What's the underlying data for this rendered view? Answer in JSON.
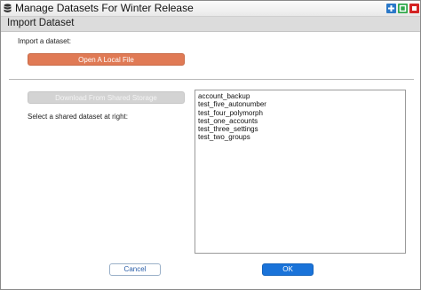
{
  "window": {
    "title": "Manage Datasets For Winter Release",
    "app_icon": "database-icon",
    "controls": {
      "maximize_icon": "plus-icon",
      "restore_icon": "square-icon",
      "close_icon": "close-icon"
    }
  },
  "header": {
    "title": "Import Dataset"
  },
  "import_section": {
    "label": "Import a dataset:",
    "local_button": "Open A Local File"
  },
  "shared_section": {
    "download_button": "Download From Shared Storage",
    "hint": "Select a shared dataset at right:",
    "datasets": [
      "account_backup",
      "test_five_autonumber",
      "test_four_polymorph",
      "test_one_accounts",
      "test_three_settings",
      "test_two_groups"
    ]
  },
  "footer": {
    "cancel_label": "Cancel",
    "ok_label": "OK"
  },
  "colors": {
    "local_button": "#e07a55",
    "ok_button": "#1a73d9",
    "maximize": "#2a78c8",
    "restore": "#2fa84a",
    "close": "#d42424"
  }
}
